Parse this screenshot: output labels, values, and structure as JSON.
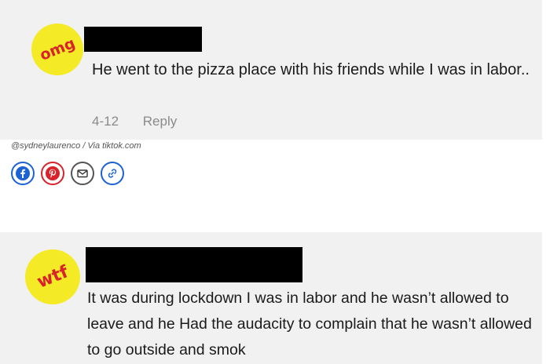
{
  "post1": {
    "badge": "omg",
    "comment": "He went to the pizza place with his friends while I was in labor..",
    "date": "4-12",
    "reply_label": "Reply"
  },
  "credit": "@sydneylaurenco / Via tiktok.com",
  "share": {
    "icons": [
      "facebook-icon",
      "pinterest-icon",
      "email-icon",
      "link-icon"
    ]
  },
  "post2": {
    "badge": "wtf",
    "comment": "It was during lockdown I was in labor and he wasn’t allowed to leave and he Had the audacity to complain that he wasn’t allowed to go outside and smok"
  },
  "colors": {
    "card_bg": "#f1f1f1",
    "badge_yellow": "#f4ea26",
    "badge_red": "#d8232a",
    "facebook_blue": "#1c62d3"
  }
}
